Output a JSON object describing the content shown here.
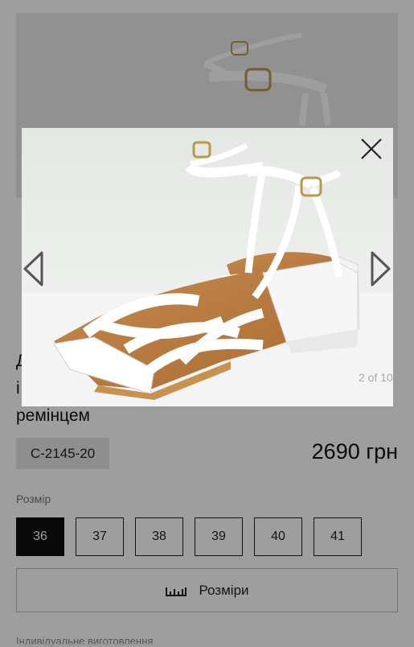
{
  "product": {
    "title_lines": [
      "Д",
      "і",
      "ремінцем"
    ],
    "article": "С-2145-20",
    "price": "2690 грн"
  },
  "sizes": {
    "label": "Розмір",
    "options": [
      "36",
      "37",
      "38",
      "39",
      "40",
      "41"
    ],
    "selected": "36"
  },
  "size_chart": {
    "label": "Розміри",
    "icon": "ruler-icon"
  },
  "custom_note": "Індивідуальне виготовлення",
  "lightbox": {
    "counter": "2 of 10",
    "close_icon": "close-icon",
    "prev_icon": "chevron-left-icon",
    "next_icon": "chevron-right-icon",
    "image": "white-strappy-block-heel-sandals",
    "colors": {
      "shoe": "#ffffff",
      "insole": "#b5773f",
      "heel": "#f2f2f2",
      "background": "#e9ebe9"
    }
  }
}
